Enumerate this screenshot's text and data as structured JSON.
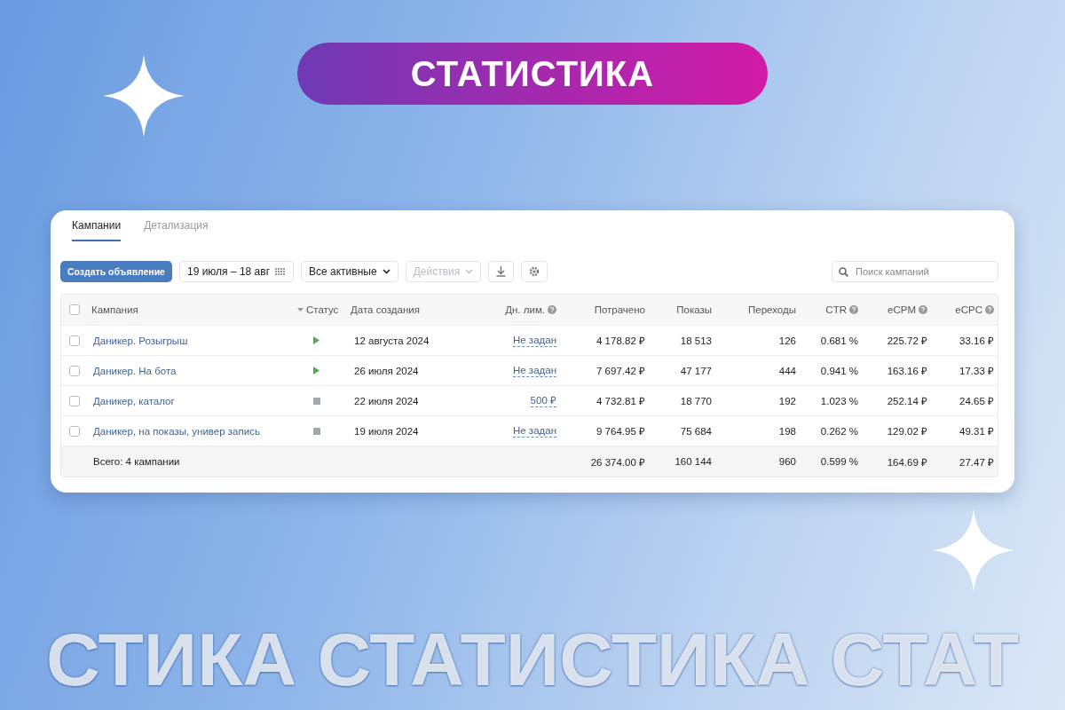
{
  "banner": {
    "title": "СТАТИСТИКА"
  },
  "tabs": [
    {
      "label": "Кампании",
      "selected": true
    },
    {
      "label": "Детализация",
      "selected": false
    }
  ],
  "toolbar": {
    "create_button": "Создать объявление",
    "date_range": "19 июля – 18 авг",
    "filter": "Все активные",
    "actions": {
      "label": "Действия",
      "disabled": true
    },
    "search": {
      "placeholder": "Поиск кампаний"
    }
  },
  "table": {
    "header_checked": false,
    "columns": [
      {
        "label": "Кампания",
        "help": false,
        "sorted": false
      },
      {
        "label": "Статус",
        "help": false,
        "sorted": true
      },
      {
        "label": "Дата создания",
        "help": false,
        "sorted": false
      },
      {
        "label": "Дн. лим.",
        "help": true,
        "sorted": false
      },
      {
        "label": "Потрачено",
        "help": false,
        "sorted": false
      },
      {
        "label": "Показы",
        "help": false,
        "sorted": false
      },
      {
        "label": "Переходы",
        "help": false,
        "sorted": false
      },
      {
        "label": "CTR",
        "help": true,
        "sorted": false
      },
      {
        "label": "eCPM",
        "help": true,
        "sorted": false
      },
      {
        "label": "eCPC",
        "help": true,
        "sorted": false
      }
    ],
    "rows": [
      {
        "checked": false,
        "name": "Даникер. Розыгрыш",
        "kind": "running",
        "date": "12 августа 2024",
        "limit": "Не задан",
        "spent": "4 178.82 ₽",
        "shows": "18 513",
        "clicks": "126",
        "ctr": "0.681 %",
        "ecpm": "225.72 ₽",
        "ecpc": "33.16 ₽"
      },
      {
        "checked": false,
        "name": "Даникер. На бота",
        "kind": "running",
        "date": "26 июля 2024",
        "limit": "Не задан",
        "spent": "7 697.42 ₽",
        "shows": "47 177",
        "clicks": "444",
        "ctr": "0.941 %",
        "ecpm": "163.16 ₽",
        "ecpc": "17.33 ₽"
      },
      {
        "checked": false,
        "name": "Даникер, каталог",
        "kind": "stopped",
        "date": "22 июля 2024",
        "limit": "500 ₽",
        "spent": "4 732.81 ₽",
        "shows": "18 770",
        "clicks": "192",
        "ctr": "1.023 %",
        "ecpm": "252.14 ₽",
        "ecpc": "24.65 ₽"
      },
      {
        "checked": false,
        "name": "Даникер, на показы, универ запись",
        "kind": "stopped",
        "date": "19 июля 2024",
        "limit": "Не задан",
        "spent": "9 764.95 ₽",
        "shows": "75 684",
        "clicks": "198",
        "ctr": "0.262 %",
        "ecpm": "129.02 ₽",
        "ecpc": "49.31 ₽"
      }
    ],
    "total": {
      "label": "Всего: 4 кампании",
      "spent": "26 374.00 ₽",
      "shows": "160 144",
      "clicks": "960",
      "ctr": "0.599 %",
      "ecpm": "164.69 ₽",
      "ecpc": "27.47 ₽"
    }
  },
  "background_text": "СТИКА СТАТИСТИКА СТАТ"
}
